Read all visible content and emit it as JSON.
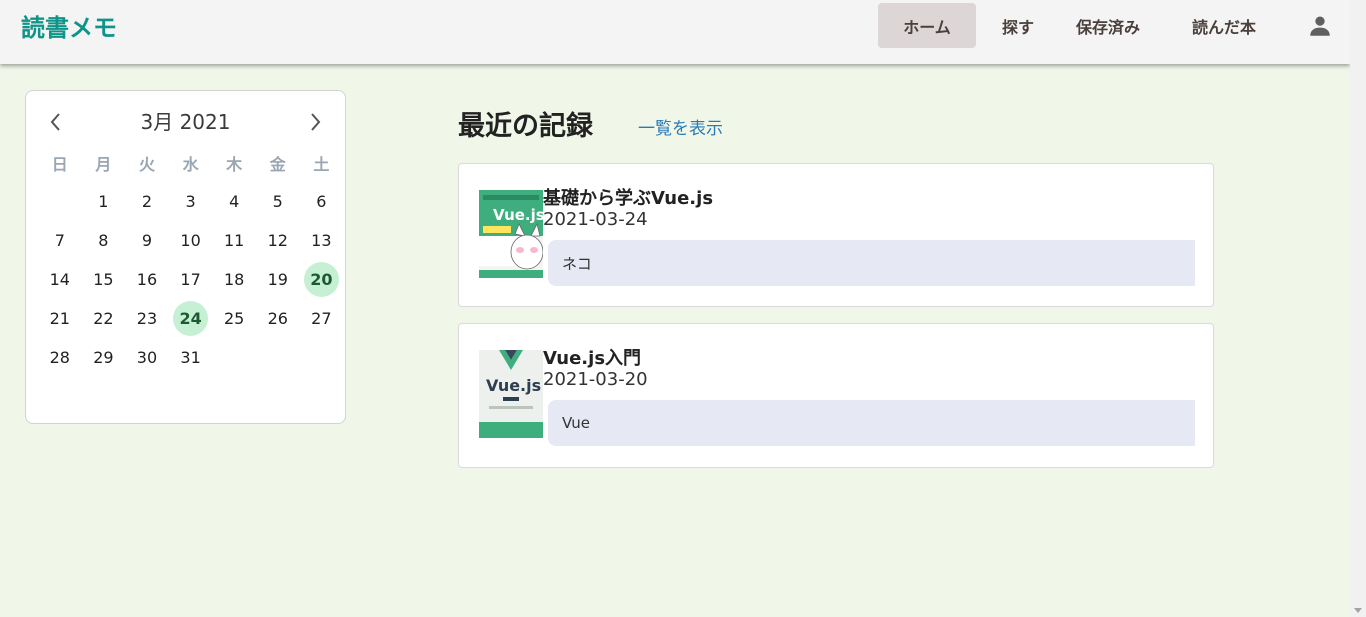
{
  "app": {
    "title": "読書メモ"
  },
  "nav": {
    "home": "ホーム",
    "search": "探す",
    "saved": "保存済み",
    "read": "読んだ本",
    "account_icon": "account-icon"
  },
  "calendar": {
    "title": "3月 2021",
    "weekdays": [
      "日",
      "月",
      "火",
      "水",
      "木",
      "金",
      "土"
    ],
    "first_weekday_offset": 1,
    "days_in_month": 31,
    "marked_days": [
      20,
      24
    ],
    "days": [
      "1",
      "2",
      "3",
      "4",
      "5",
      "6",
      "7",
      "8",
      "9",
      "10",
      "11",
      "12",
      "13",
      "14",
      "15",
      "16",
      "17",
      "18",
      "19",
      "20",
      "21",
      "22",
      "23",
      "24",
      "25",
      "26",
      "27",
      "28",
      "29",
      "30",
      "31"
    ]
  },
  "recent": {
    "title": "最近の記録",
    "view_all": "一覧を表示",
    "records": [
      {
        "title": "基礎から学ぶVue.js",
        "date": "2021-03-24",
        "memo": "ネコ",
        "cover_text": "Vue.js"
      },
      {
        "title": "Vue.js入門",
        "date": "2021-03-20",
        "memo": "Vue",
        "cover_text": "Vue.js"
      }
    ]
  },
  "colors": {
    "brand": "#0f9488",
    "background": "#f0f6e8",
    "marked_day": "#c6f0d4",
    "memo_bg": "#e6e8f4",
    "link": "#2a7ab8"
  }
}
